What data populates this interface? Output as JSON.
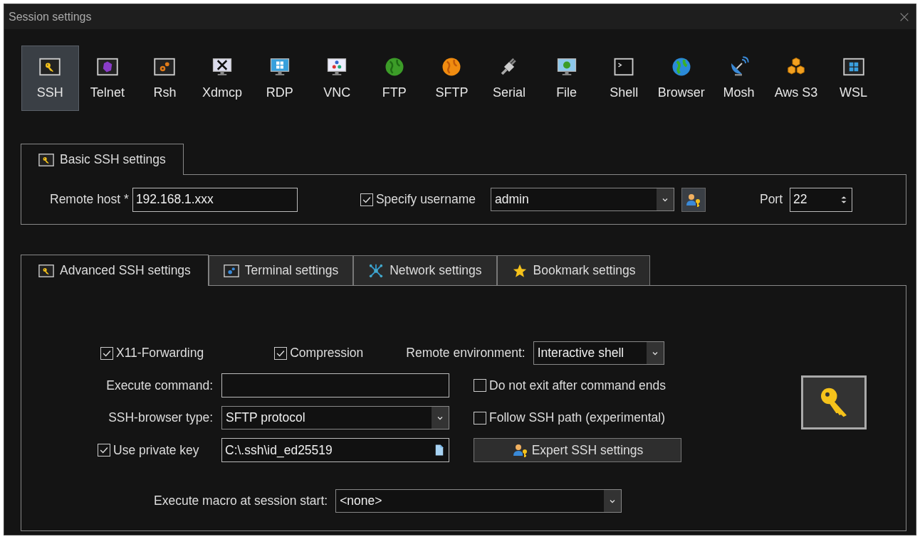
{
  "window": {
    "title": "Session settings"
  },
  "session_types": [
    {
      "label": "SSH",
      "selected": true
    },
    {
      "label": "Telnet",
      "selected": false
    },
    {
      "label": "Rsh",
      "selected": false
    },
    {
      "label": "Xdmcp",
      "selected": false
    },
    {
      "label": "RDP",
      "selected": false
    },
    {
      "label": "VNC",
      "selected": false
    },
    {
      "label": "FTP",
      "selected": false
    },
    {
      "label": "SFTP",
      "selected": false
    },
    {
      "label": "Serial",
      "selected": false
    },
    {
      "label": "File",
      "selected": false
    },
    {
      "label": "Shell",
      "selected": false
    },
    {
      "label": "Browser",
      "selected": false
    },
    {
      "label": "Mosh",
      "selected": false
    },
    {
      "label": "Aws S3",
      "selected": false
    },
    {
      "label": "WSL",
      "selected": false
    }
  ],
  "basic_settings": {
    "tab_label": "Basic SSH settings",
    "remote_host": {
      "label": "Remote host *",
      "value": "192.168.1.xxx"
    },
    "specify_username": {
      "label": "Specify username",
      "checked": true
    },
    "username": {
      "value": "admin"
    },
    "port": {
      "label": "Port",
      "value": "22"
    }
  },
  "advanced_tabs": [
    {
      "label": "Advanced SSH settings",
      "selected": true
    },
    {
      "label": "Terminal settings",
      "selected": false
    },
    {
      "label": "Network settings",
      "selected": false
    },
    {
      "label": "Bookmark settings",
      "selected": false
    }
  ],
  "advanced_settings": {
    "x11_forwarding": {
      "label": "X11-Forwarding",
      "checked": true
    },
    "compression": {
      "label": "Compression",
      "checked": true
    },
    "remote_environment": {
      "label": "Remote environment:",
      "value": "Interactive shell"
    },
    "execute_command": {
      "label": "Execute command:"
    },
    "do_not_exit": {
      "label": "Do not exit after command ends",
      "checked": false
    },
    "ssh_browser_type": {
      "label": "SSH-browser type:",
      "value": "SFTP protocol"
    },
    "follow_ssh_path": {
      "label": "Follow SSH path (experimental)",
      "checked": false
    },
    "use_private_key": {
      "label": "Use private key",
      "checked": true,
      "value": "C:\\.ssh\\id_ed25519"
    },
    "expert_button": {
      "label": "Expert SSH settings"
    },
    "execute_macro": {
      "label": "Execute macro at session start:",
      "value": "<none>"
    }
  }
}
